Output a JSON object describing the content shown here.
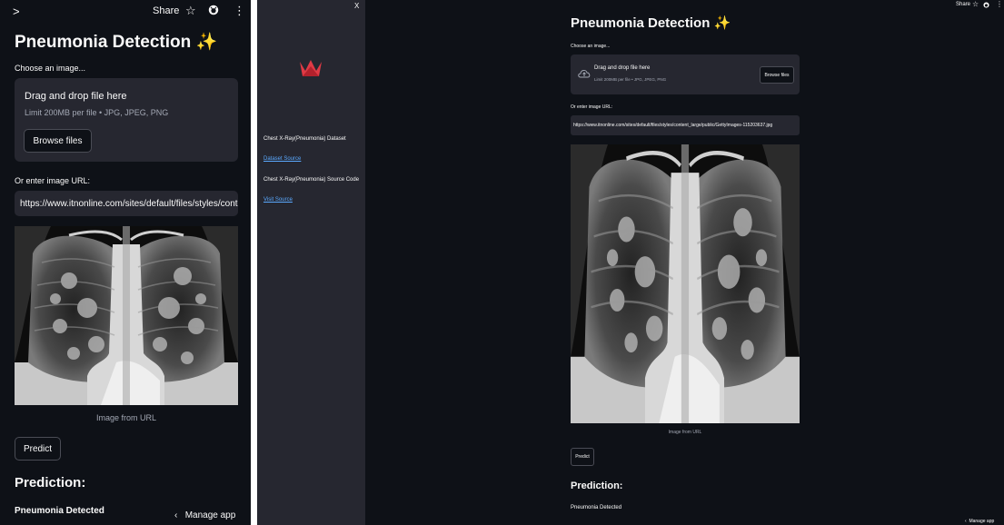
{
  "colors": {
    "app_bg": "#0e1117",
    "sidebar_bg": "#262730",
    "widget_bg": "#262730",
    "text": "#fafafa",
    "muted": "#a3a8b4",
    "link": "#5aa9ff",
    "logo": "#e03a45"
  },
  "header": {
    "share_label": "Share",
    "sidebar_toggle_icon": "chevron-right-icon",
    "star_icon": "star-icon",
    "github_icon": "github-icon",
    "menu_icon": "kebab-menu-icon"
  },
  "app": {
    "title": "Pneumonia Detection ✨",
    "uploader": {
      "label": "Choose an image...",
      "drop_text": "Drag and drop file here",
      "limit_text": "Limit 200MB per file • JPG, JPEG, PNG",
      "browse_label": "Browse files"
    },
    "url_input": {
      "label": "Or enter image URL:",
      "value": "https://www.itnonline.com/sites/default/files/styles/content_large/public/GettyImages-115203637.jpg"
    },
    "image_caption": "Image from URL",
    "predict_label": "Predict",
    "prediction_heading": "Prediction:",
    "prediction_result": "Pneumonia Detected"
  },
  "sidebar": {
    "close_label": "X",
    "items": [
      {
        "text": "Chest X-Ray(Pneumonia) Dataset",
        "is_link": false
      },
      {
        "text": "Dataset Source",
        "is_link": true
      },
      {
        "text": "Chest X-Ray(Pneumonia) Source Code",
        "is_link": false
      },
      {
        "text": "Visit Source",
        "is_link": true
      }
    ]
  },
  "footer": {
    "manage_label": "Manage app"
  }
}
